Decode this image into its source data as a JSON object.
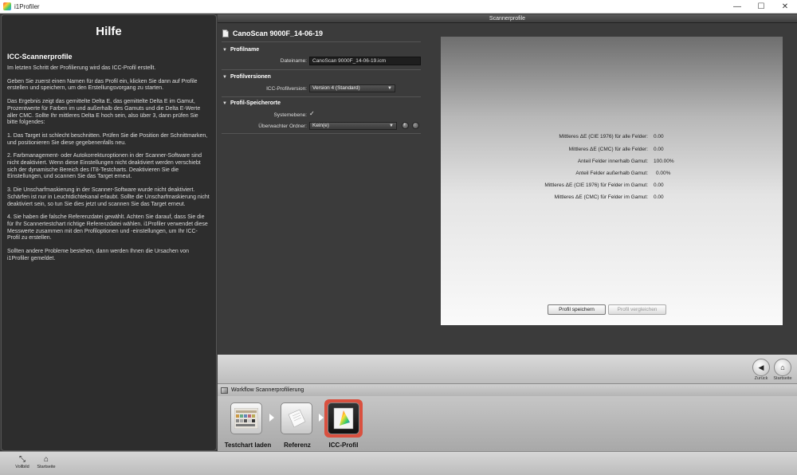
{
  "window": {
    "title": "i1Profiler",
    "minimize": "—",
    "maximize": "☐",
    "close": "✕"
  },
  "help": {
    "title": "Hilfe",
    "subtitle": "ICC-Scannerprofile",
    "paragraphs": [
      "Im letzten Schritt der Profilierung wird das ICC-Profil erstellt.",
      "Geben Sie zuerst einen Namen für das Profil ein, klicken Sie dann auf Profile erstellen und speichern, um den Erstellungsvorgang zu starten.",
      "Das Ergebnis zeigt das gemittelte Delta E, das gemittelte Delta E im Gamut, Prozentwerte für Farben im und außerhalb des Gamuts und die Delta E-Werte aller CMC. Sollte Ihr mittleres Delta E hoch sein, also über 3, dann prüfen Sie bitte folgendes:",
      "1. Das Target ist schlecht beschnitten. Prüfen Sie die Position der Schnittmarken, und positionieren Sie diese gegebenenfalls neu.",
      "2. Farbmanagement- oder Autokorrekturoptionen in der Scanner-Software sind nicht deaktiviert. Wenn diese Einstellungen nicht deaktiviert werden verschiebt sich der dynamische Bereich des IT8-Testcharts. Deaktivieren Sie die Einstellungen, und scannen Sie das Target erneut.",
      "3. Die Unscharfmaskierung in der Scanner-Software wurde nicht deaktiviert. Schärfen ist nur in Leuchtdichtekanal erlaubt. Sollte die Unscharfmaskierung nicht deaktiviert sein, so tun Sie dies jetzt und scannen Sie das Target erneut.",
      "4. Sie haben die falsche Referenzdatei gewählt. Achten Sie darauf, dass Sie die für Ihr Scannertestchart richtige Referenzdatei wählen. i1Profiler verwendet diese Messwerte zusammen mit den Profiloptionen und -einstellungen, um Ihr ICC-Profil zu erstellen.",
      "Sollten andere Probleme bestehen, dann werden Ihnen die Ursachen von i1Profiler gemeldet."
    ]
  },
  "main": {
    "header": "Scannerprofile",
    "profile_title": "CanoScan 9000F_14-06-19",
    "sections": {
      "profilname": {
        "title": "Profilname",
        "dateiname_label": "Dateiname:",
        "dateiname_value": "CanoScan 9000F_14-06-19.icm"
      },
      "profilversionen": {
        "title": "Profilversionen",
        "version_label": "ICC-Profilversion:",
        "version_value": "Version 4 (Standard)"
      },
      "speicherorte": {
        "title": "Profil-Speicherorte",
        "systemebene_label": "Systemebene:",
        "systemebene_checked": true,
        "ordner_label": "Überwachter Ordner:",
        "ordner_value": "Kein(e)"
      }
    },
    "results": [
      {
        "label": "Mittleres ΔE (CIE 1976) für alle Felder:",
        "value": "0.00"
      },
      {
        "label": "Mittleres ΔE (CMC) für alle Felder:",
        "value": "0.00"
      },
      {
        "label": "Anteil Felder innerhalb Gamut:",
        "value": "100.00%"
      },
      {
        "label": "Anteil Felder außerhalb Gamut:",
        "value": "0.00%"
      },
      {
        "label": "Mittleres ΔE (CIE 1976) für Felder im Gamut:",
        "value": "0.00"
      },
      {
        "label": "Mittleres ΔE (CMC) für Felder im Gamut:",
        "value": "0.00"
      }
    ],
    "save_button": "Profil speichern",
    "compare_button": "Profil vergleichen"
  },
  "nav": {
    "back_label": "Zurück",
    "home_label": "Startseite"
  },
  "workflow": {
    "title": "Workflow Scannerprofilierung",
    "steps": [
      {
        "label": "Testchart laden"
      },
      {
        "label": "Referenz"
      },
      {
        "label": "ICC-Profil"
      }
    ]
  },
  "bottom": {
    "fullscreen_label": "Vollbild",
    "home_label": "Startseite"
  },
  "colors": {
    "accent": "#d9503f"
  }
}
